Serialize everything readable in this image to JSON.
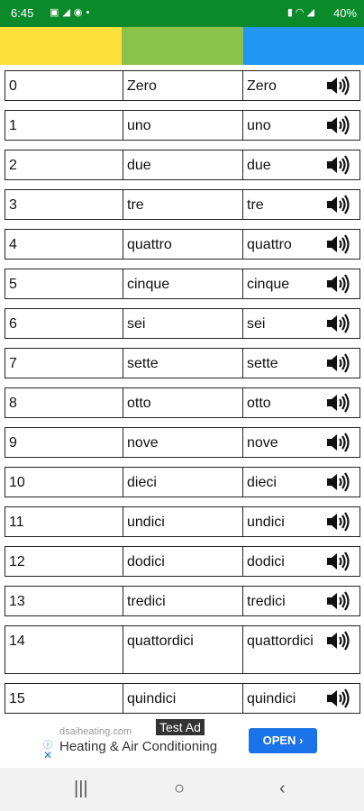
{
  "status_bar": {
    "time": "6:45",
    "battery": "40%",
    "icons_left": [
      "gallery-icon",
      "telegram-icon",
      "messenger-icon",
      "dot-icon"
    ],
    "icons_right": [
      "battery-saver-icon",
      "wifi-icon",
      "signal-icon"
    ]
  },
  "header_colors": [
    "#fde13a",
    "#8bc34a",
    "#2196f3"
  ],
  "rows": [
    {
      "num": "0",
      "italian": "Zero",
      "translit": "Zero"
    },
    {
      "num": "1",
      "italian": "uno",
      "translit": "uno"
    },
    {
      "num": "2",
      "italian": "due",
      "translit": "due"
    },
    {
      "num": "3",
      "italian": "tre",
      "translit": "tre"
    },
    {
      "num": "4",
      "italian": "quattro",
      "translit": "quattro"
    },
    {
      "num": "5",
      "italian": "cinque",
      "translit": "cinque"
    },
    {
      "num": "6",
      "italian": "sei",
      "translit": "sei"
    },
    {
      "num": "7",
      "italian": "sette",
      "translit": "sette"
    },
    {
      "num": "8",
      "italian": "otto",
      "translit": "otto"
    },
    {
      "num": "9",
      "italian": "nove",
      "translit": "nove"
    },
    {
      "num": "10",
      "italian": "dieci",
      "translit": "dieci"
    },
    {
      "num": "11",
      "italian": "undici",
      "translit": "undici"
    },
    {
      "num": "12",
      "italian": "dodici",
      "translit": "dodici"
    },
    {
      "num": "13",
      "italian": "tredici",
      "translit": "tredici"
    },
    {
      "num": "14",
      "italian": "quattordici",
      "translit": "quattordici"
    },
    {
      "num": "15",
      "italian": "quindici",
      "translit": "quindici"
    }
  ],
  "ad": {
    "badge": "Test Ad",
    "domain": "dsaiheating.com",
    "title": "Heating & Air Conditioning",
    "cta": "OPEN ›"
  },
  "nav": {
    "recents": "|||",
    "home": "○",
    "back": "‹"
  }
}
